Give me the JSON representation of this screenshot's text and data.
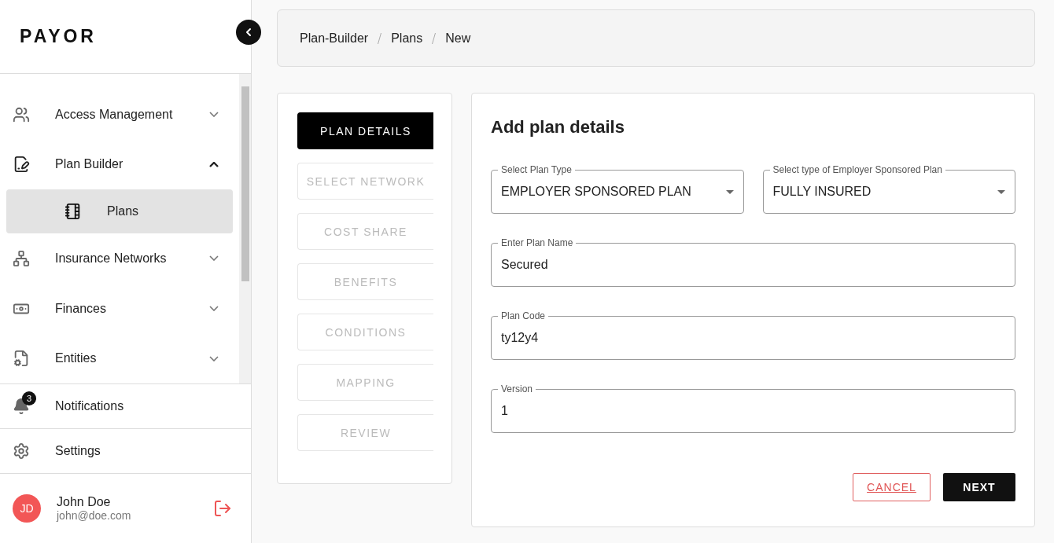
{
  "logo": "PAYOR",
  "nav": [
    {
      "label": "Access Management",
      "expanded": false
    },
    {
      "label": "Plan Builder",
      "expanded": true,
      "children": [
        {
          "label": "Plans",
          "selected": true
        }
      ]
    },
    {
      "label": "Insurance Networks",
      "expanded": false
    },
    {
      "label": "Finances",
      "expanded": false
    },
    {
      "label": "Entities",
      "expanded": false
    }
  ],
  "notifications": {
    "label": "Notifications",
    "count": "3"
  },
  "settings": {
    "label": "Settings"
  },
  "user": {
    "initials": "JD",
    "name": "John Doe",
    "email": "john@doe.com"
  },
  "breadcrumb": [
    "Plan-Builder",
    "Plans",
    "New"
  ],
  "steps": [
    {
      "label": "PLAN DETAILS",
      "selected": true
    },
    {
      "label": "SELECT NETWORK",
      "selected": false
    },
    {
      "label": "COST SHARE",
      "selected": false
    },
    {
      "label": "BENEFITS",
      "selected": false
    },
    {
      "label": "CONDITIONS",
      "selected": false
    },
    {
      "label": "MAPPING",
      "selected": false
    },
    {
      "label": "REVIEW",
      "selected": false
    }
  ],
  "form": {
    "title": "Add plan details",
    "rows": [
      [
        {
          "kind": "select",
          "label": "Select Plan Type",
          "value": "EMPLOYER SPONSORED PLAN"
        },
        {
          "kind": "select",
          "label": "Select type of Employer Sponsored Plan",
          "value": "FULLY INSURED"
        }
      ],
      [
        {
          "kind": "text",
          "label": "Enter Plan Name",
          "value": "Secured"
        }
      ],
      [
        {
          "kind": "text",
          "label": "Plan Code",
          "value": "ty12y4"
        }
      ],
      [
        {
          "kind": "text",
          "label": "Version",
          "value": "1"
        }
      ]
    ],
    "cancel": "CANCEL",
    "next": "NEXT"
  }
}
